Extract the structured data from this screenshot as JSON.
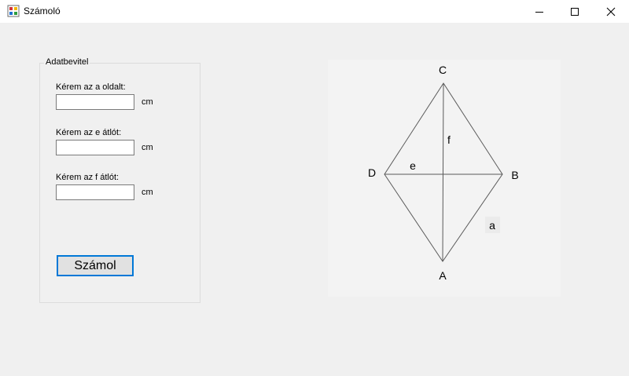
{
  "window": {
    "title": "Számoló"
  },
  "group": {
    "title": "Adatbevitel"
  },
  "fields": [
    {
      "label": "Kérem az a oldalt:",
      "value": "",
      "unit": "cm"
    },
    {
      "label": "Kérem az e átlót:",
      "value": "",
      "unit": "cm"
    },
    {
      "label": "Kérem az f átlót:",
      "value": "",
      "unit": "cm"
    }
  ],
  "actions": {
    "calculate_label": "Számol"
  },
  "diagram": {
    "vertex_a": "A",
    "vertex_b": "B",
    "vertex_c": "C",
    "vertex_d": "D",
    "diagonal_e": "e",
    "diagonal_f": "f",
    "side_a": "a"
  },
  "icons": {
    "app": "app-icon",
    "minimize": "minimize-icon",
    "maximize": "maximize-icon",
    "close": "close-icon"
  }
}
